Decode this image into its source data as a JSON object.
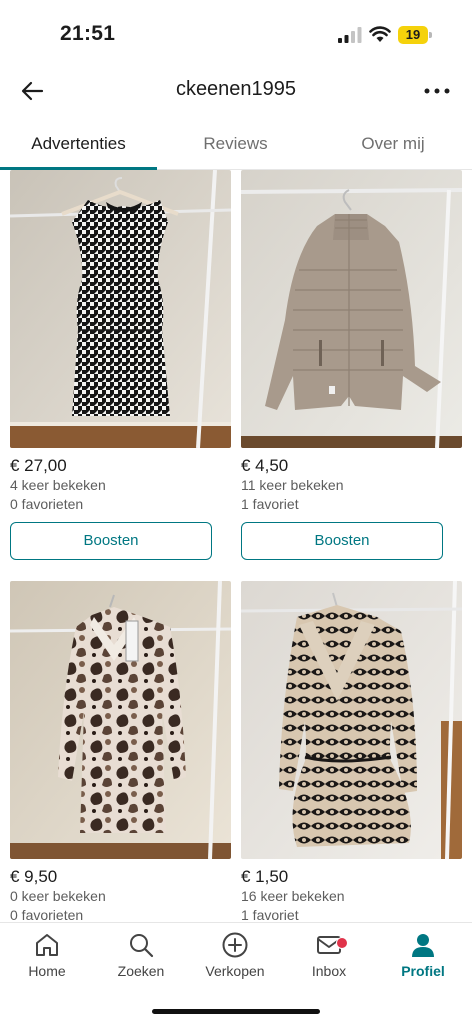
{
  "status_bar": {
    "time": "21:51",
    "battery": "19",
    "battery_color": "#f5d20b"
  },
  "header": {
    "title": "ckeenen1995",
    "back_icon": "arrow-left-icon",
    "more_icon": "more-horizontal-icon"
  },
  "tabs": [
    {
      "label": "Advertenties",
      "active": true
    },
    {
      "label": "Reviews",
      "active": false
    },
    {
      "label": "Over mij",
      "active": false
    }
  ],
  "listings": [
    {
      "price": "€ 27,00",
      "views": "4 keer bekeken",
      "favorites": "0 favorieten",
      "button": "Boosten"
    },
    {
      "price": "€ 4,50",
      "views": "11 keer bekeken",
      "favorites": "1 favoriet",
      "button": "Boosten"
    },
    {
      "price": "€ 9,50",
      "views": "0 keer bekeken",
      "favorites": "0 favorieten"
    },
    {
      "price": "€ 1,50",
      "views": "16 keer bekeken",
      "favorites": "1 favoriet"
    }
  ],
  "bottom_nav": [
    {
      "label": "Home",
      "icon": "home-icon",
      "active": false
    },
    {
      "label": "Zoeken",
      "icon": "search-icon",
      "active": false
    },
    {
      "label": "Verkopen",
      "icon": "plus-circle-icon",
      "active": false
    },
    {
      "label": "Inbox",
      "icon": "mail-icon",
      "active": false,
      "badge": true
    },
    {
      "label": "Profiel",
      "icon": "profile-icon",
      "active": true
    }
  ],
  "colors": {
    "accent": "#007782",
    "badge": "#e0334a"
  }
}
